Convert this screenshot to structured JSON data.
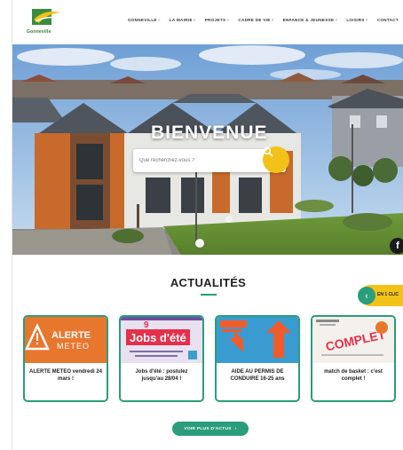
{
  "brand": {
    "name": "Gonneville",
    "colors": {
      "accent": "#2b9d7c",
      "yellow": "#f2c218"
    }
  },
  "nav": {
    "items": [
      {
        "label": "GONNEVILLE"
      },
      {
        "label": "LA MAIRIE"
      },
      {
        "label": "PROJETS"
      },
      {
        "label": "CADRE DE VIE"
      },
      {
        "label": "ENFANCE & JEUNESSE"
      },
      {
        "label": "LOISIRS"
      },
      {
        "label": "CONTACT"
      }
    ]
  },
  "hero": {
    "title": "BIENVENUE",
    "search": {
      "placeholder": "Que recherchez-vous ?",
      "icon": "search-icon"
    },
    "social": {
      "label": "f",
      "icon": "facebook-icon"
    }
  },
  "news": {
    "title": "ACTUALITÉS",
    "quick_access": {
      "label": "EN 1 CLIC",
      "icon": "chevron-left-icon"
    },
    "cards": [
      {
        "image_text": "ALERTE",
        "image_subtext": "METEO",
        "caption": "ALERTE METEO vendredi 24 mars !"
      },
      {
        "image_text": "Jobs d'été",
        "caption": "Jobs d'été : postulez jusqu'au 28/04 !"
      },
      {
        "image_text": "",
        "caption": "AIDE AU PERMIS DE CONDUIRE 16-25 ans"
      },
      {
        "image_text": "COMPLET",
        "caption": "match de basket : c'est complet !"
      }
    ],
    "more_button": "VOIR PLUS D'ACTUS",
    "more_icon": "chevron-right-icon"
  }
}
